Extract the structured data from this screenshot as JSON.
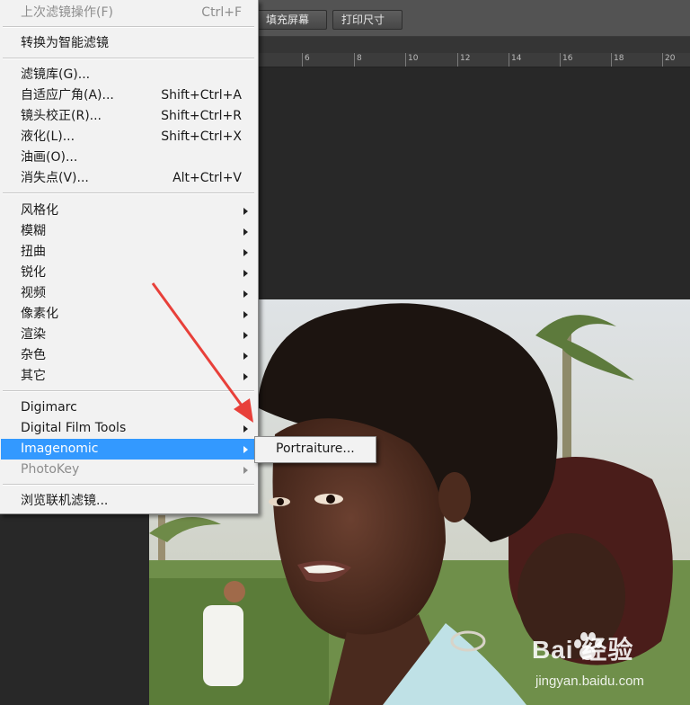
{
  "options_bar": {
    "fill_screen": "填充屏幕",
    "print_size": "打印尺寸"
  },
  "ruler": {
    "labels": [
      "6",
      "8",
      "10",
      "12",
      "14",
      "16",
      "18",
      "20"
    ]
  },
  "menu": {
    "last_filter": {
      "label": "上次滤镜操作(F)",
      "shortcut": "Ctrl+F"
    },
    "smart_filter": "转换为智能滤镜",
    "filter_gallery": "滤镜库(G)...",
    "adaptive_wide": {
      "label": "自适应广角(A)...",
      "shortcut": "Shift+Ctrl+A"
    },
    "lens_correction": {
      "label": "镜头校正(R)...",
      "shortcut": "Shift+Ctrl+R"
    },
    "liquify": {
      "label": "液化(L)...",
      "shortcut": "Shift+Ctrl+X"
    },
    "oil_paint": "油画(O)...",
    "vanishing_point": {
      "label": "消失点(V)...",
      "shortcut": "Alt+Ctrl+V"
    },
    "groups": [
      "风格化",
      "模糊",
      "扭曲",
      "锐化",
      "视频",
      "像素化",
      "渲染",
      "杂色",
      "其它"
    ],
    "digimarc": "Digimarc",
    "digital_film_tools": "Digital Film Tools",
    "imagenomic": "Imagenomic",
    "photokey": "PhotoKey",
    "browse_online": "浏览联机滤镜..."
  },
  "submenu": {
    "portraiture": "Portraiture..."
  },
  "watermark": {
    "brand": "Bai 经验",
    "site": "jingyan.baidu.com"
  },
  "colors": {
    "highlight": "#3399ff",
    "arrow": "#e8403a"
  }
}
